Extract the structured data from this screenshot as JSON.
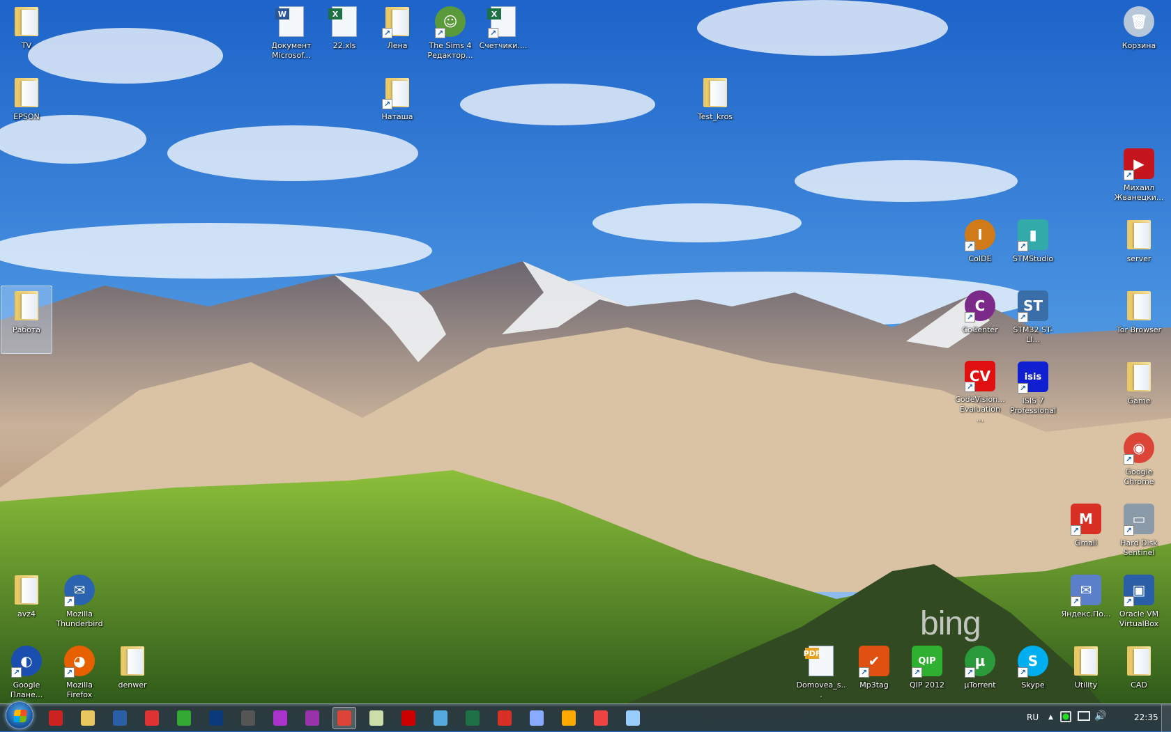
{
  "desktop": {
    "watermark": "bing",
    "icons": [
      {
        "label": "TV",
        "kind": "folder",
        "shortcut": false
      },
      {
        "label": "Документ Microsof...",
        "kind": "doc",
        "color": "#2b5797",
        "letter": "W",
        "shortcut": false
      },
      {
        "label": "22.xls",
        "kind": "doc",
        "color": "#1e7145",
        "letter": "X",
        "shortcut": false
      },
      {
        "label": "Лена",
        "kind": "folder",
        "shortcut": true
      },
      {
        "label": "The Sims 4 Редактор...",
        "kind": "app",
        "color": "#5a9a3a",
        "letter": "☺",
        "shortcut": true
      },
      {
        "label": "Счетчики....",
        "kind": "doc",
        "color": "#1e7145",
        "letter": "X",
        "shortcut": true
      },
      {
        "label": "Корзина",
        "kind": "app",
        "color": "#b8c8d8",
        "letter": "🗑",
        "shortcut": false
      },
      {
        "label": "EPSON",
        "kind": "folder",
        "shortcut": false
      },
      {
        "label": "Наташа",
        "kind": "folder",
        "shortcut": true
      },
      {
        "label": "Test_kros",
        "kind": "folder",
        "shortcut": false
      },
      {
        "label": "Михаил Жванецки...",
        "kind": "app",
        "color": "#c4161c",
        "letter": "▶",
        "square": true,
        "shortcut": true
      },
      {
        "label": "CoIDE",
        "kind": "app",
        "color": "#d07a1a",
        "letter": "I",
        "shortcut": true
      },
      {
        "label": "STMStudio",
        "kind": "app",
        "color": "#3aa",
        "letter": "▮",
        "square": true,
        "shortcut": true
      },
      {
        "label": "server",
        "kind": "folder",
        "shortcut": false
      },
      {
        "label": "Работа",
        "kind": "folder",
        "shortcut": false,
        "selected": true
      },
      {
        "label": "CoCenter",
        "kind": "app",
        "color": "#7b2a8a",
        "letter": "C",
        "shortcut": true
      },
      {
        "label": "STM32 ST-LI...",
        "kind": "app",
        "color": "#3a6ea8",
        "letter": "ST",
        "square": true,
        "shortcut": true
      },
      {
        "label": "Tor Browser",
        "kind": "folder",
        "shortcut": false
      },
      {
        "label": "CodeVision... Evaluation ...",
        "kind": "app",
        "color": "#e01010",
        "letter": "CV",
        "square": true,
        "shortcut": true
      },
      {
        "label": "ISIS 7 Professional",
        "kind": "app",
        "color": "#1020d0",
        "letter": "isis",
        "square": true,
        "shortcut": true
      },
      {
        "label": "Game",
        "kind": "folder",
        "shortcut": false
      },
      {
        "label": "Google Chrome",
        "kind": "app",
        "color": "#db4437",
        "letter": "◉",
        "shortcut": true
      },
      {
        "label": "Gmail",
        "kind": "app",
        "color": "#d93025",
        "letter": "M",
        "square": true,
        "shortcut": true
      },
      {
        "label": "Hard Disk Sentinel",
        "kind": "app",
        "color": "#8a9aa8",
        "letter": "▭",
        "square": true,
        "shortcut": true
      },
      {
        "label": "avz4",
        "kind": "folder",
        "shortcut": false
      },
      {
        "label": "Mozilla Thunderbird",
        "kind": "app",
        "color": "#2a64b0",
        "letter": "✉",
        "shortcut": true
      },
      {
        "label": "Яндекс.По...",
        "kind": "app",
        "color": "#5b7fc8",
        "letter": "✉",
        "square": true,
        "shortcut": true
      },
      {
        "label": "Oracle VM VirtualBox",
        "kind": "app",
        "color": "#2a5fa8",
        "letter": "▣",
        "square": true,
        "shortcut": true
      },
      {
        "label": "Google Плане...",
        "kind": "app",
        "color": "#1a4fb0",
        "letter": "◐",
        "shortcut": true
      },
      {
        "label": "Mozilla Firefox",
        "kind": "app",
        "color": "#e66000",
        "letter": "◕",
        "shortcut": true
      },
      {
        "label": "denwer",
        "kind": "folder",
        "shortcut": false
      },
      {
        "label": "Domovea_s...",
        "kind": "doc",
        "color": "#e8a020",
        "letter": "PDF",
        "shortcut": false
      },
      {
        "label": "Mp3tag",
        "kind": "app",
        "color": "#e05010",
        "letter": "✔",
        "square": true,
        "shortcut": true
      },
      {
        "label": "QIP 2012",
        "kind": "app",
        "color": "#30b030",
        "letter": "QIP",
        "square": true,
        "shortcut": true
      },
      {
        "label": "µTorrent",
        "kind": "app",
        "color": "#2a9a3a",
        "letter": "µ",
        "shortcut": true
      },
      {
        "label": "Skype",
        "kind": "app",
        "color": "#00aff0",
        "letter": "S",
        "shortcut": true
      },
      {
        "label": "Utility",
        "kind": "folder",
        "shortcut": false
      },
      {
        "label": "CAD",
        "kind": "folder",
        "shortcut": false
      }
    ]
  },
  "taskbar": {
    "pinned": [
      {
        "name": "paint",
        "color": "#c22"
      },
      {
        "name": "explorer",
        "color": "#e8c660"
      },
      {
        "name": "save-tool",
        "color": "#2a5fa8"
      },
      {
        "name": "screen-tool",
        "color": "#d33"
      },
      {
        "name": "download-manager",
        "color": "#3a3"
      },
      {
        "name": "photoshop",
        "color": "#0a3a7a"
      },
      {
        "name": "device-tool",
        "color": "#555"
      },
      {
        "name": "app-purple",
        "color": "#a3c"
      },
      {
        "name": "app-purple-2",
        "color": "#93a"
      },
      {
        "name": "chrome",
        "color": "#db4437",
        "active": true
      },
      {
        "name": "notepad",
        "color": "#cda"
      },
      {
        "name": "acrobat",
        "color": "#c00"
      },
      {
        "name": "pen-tool",
        "color": "#5ad"
      },
      {
        "name": "excel",
        "color": "#1e7145"
      },
      {
        "name": "gmail",
        "color": "#d93025"
      },
      {
        "name": "mail",
        "color": "#8af"
      },
      {
        "name": "aimp",
        "color": "#fa0"
      },
      {
        "name": "ccleaner",
        "color": "#e44"
      },
      {
        "name": "calculator",
        "color": "#9cf"
      }
    ],
    "tray": {
      "language": "RU",
      "time": "22:35"
    }
  }
}
